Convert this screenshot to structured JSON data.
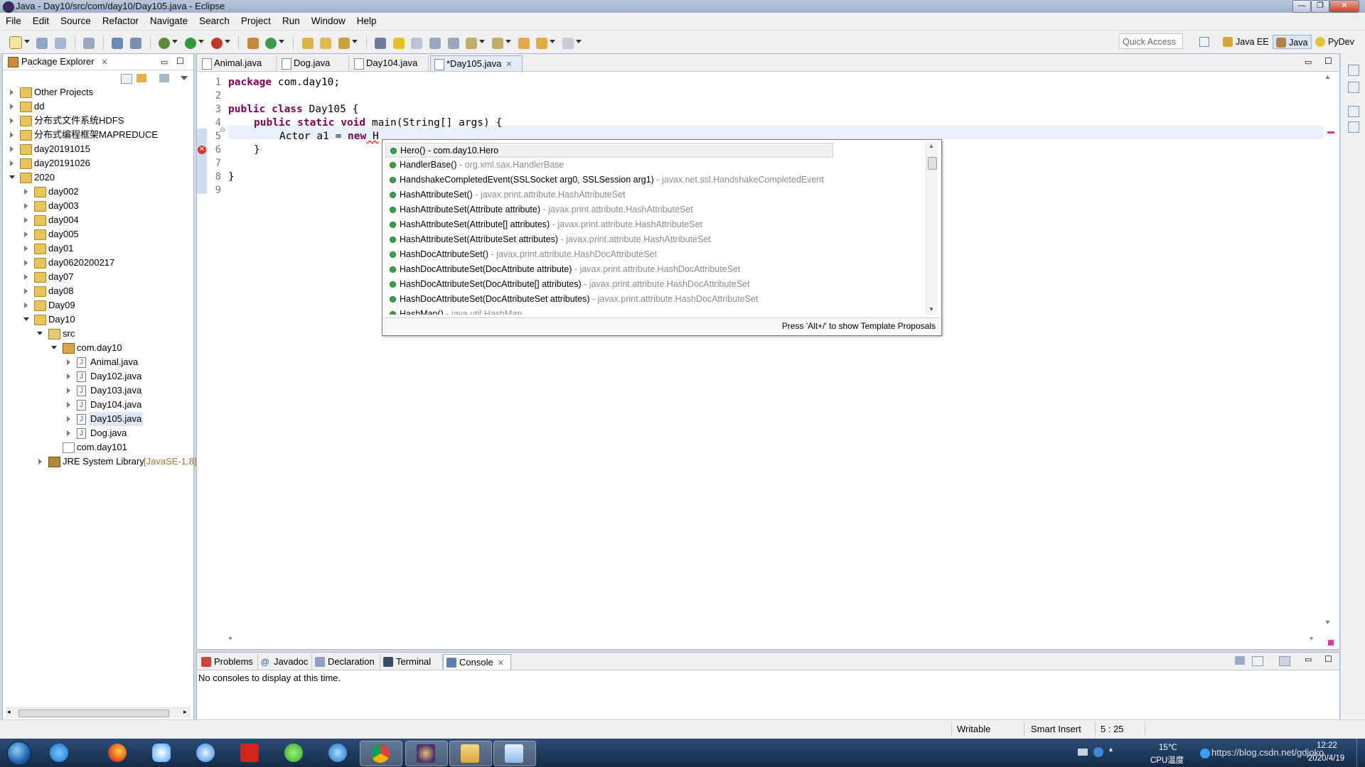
{
  "window": {
    "title": "Java - Day10/src/com/day10/Day105.java - Eclipse",
    "controls": [
      "—",
      "❐",
      "✕"
    ]
  },
  "menubar": [
    "File",
    "Edit",
    "Source",
    "Refactor",
    "Navigate",
    "Search",
    "Project",
    "Run",
    "Window",
    "Help"
  ],
  "toolbar": {
    "quick_access": "Quick Access",
    "perspectives": [
      "Java EE",
      "Java",
      "PyDev"
    ]
  },
  "package_explorer": {
    "title": "Package Explorer",
    "items": [
      {
        "label": "Other Projects"
      },
      {
        "label": "dd"
      },
      {
        "label": "分布式文件系统HDFS"
      },
      {
        "label": "分布式编程框架MAPREDUCE"
      },
      {
        "label": "day20191015"
      },
      {
        "label": "day20191026"
      },
      {
        "label": "2020"
      },
      {
        "label": "day002"
      },
      {
        "label": "day003"
      },
      {
        "label": "day004"
      },
      {
        "label": "day005"
      },
      {
        "label": "day01"
      },
      {
        "label": "day0620200217"
      },
      {
        "label": "day07"
      },
      {
        "label": "day08"
      },
      {
        "label": "Day09"
      },
      {
        "label": "Day10"
      },
      {
        "label": "src"
      },
      {
        "label": "com.day10"
      },
      {
        "label": "Animal.java"
      },
      {
        "label": "Day102.java"
      },
      {
        "label": "Day103.java"
      },
      {
        "label": "Day104.java"
      },
      {
        "label": "Day105.java"
      },
      {
        "label": "Dog.java"
      },
      {
        "label": "com.day101"
      },
      {
        "label": "JRE System Library",
        "decoration": "[JavaSE-1.8]"
      }
    ]
  },
  "editor": {
    "tabs": [
      "Animal.java",
      "Dog.java",
      "Day104.java",
      "*Day105.java"
    ],
    "line_numbers": [
      "1",
      "2",
      "3",
      "4",
      "5",
      "6",
      "7",
      "8",
      "9"
    ],
    "code": {
      "l1_kw": "package",
      "l1_rest": " com.day10;",
      "l3_kw": "public class",
      "l3_rest": " Day105 {",
      "l4_kw1": "public static void",
      "l4_rest": " main(String[] args) {",
      "l5_a": "Actor a1 = ",
      "l5_kw": "new",
      "l5_b": " H",
      "l6": "}",
      "l8": "}"
    }
  },
  "content_assist": {
    "proposals": [
      {
        "name": "Hero()",
        "qualifier": " - com.day10.Hero"
      },
      {
        "name": "HandlerBase()",
        "qualifier": " - org.xml.sax.HandlerBase"
      },
      {
        "name": "HandshakeCompletedEvent(SSLSocket arg0, SSLSession arg1)",
        "qualifier": " - javax.net.ssl.HandshakeCompletedEvent"
      },
      {
        "name": "HashAttributeSet()",
        "qualifier": " - javax.print.attribute.HashAttributeSet"
      },
      {
        "name": "HashAttributeSet(Attribute attribute)",
        "qualifier": " - javax.print.attribute.HashAttributeSet"
      },
      {
        "name": "HashAttributeSet(Attribute[] attributes)",
        "qualifier": " - javax.print.attribute.HashAttributeSet"
      },
      {
        "name": "HashAttributeSet(AttributeSet attributes)",
        "qualifier": " - javax.print.attribute.HashAttributeSet"
      },
      {
        "name": "HashDocAttributeSet()",
        "qualifier": " - javax.print.attribute.HashDocAttributeSet"
      },
      {
        "name": "HashDocAttributeSet(DocAttribute attribute)",
        "qualifier": " - javax.print.attribute.HashDocAttributeSet"
      },
      {
        "name": "HashDocAttributeSet(DocAttribute[] attributes)",
        "qualifier": " - javax.print.attribute.HashDocAttributeSet"
      },
      {
        "name": "HashDocAttributeSet(DocAttributeSet attributes)",
        "qualifier": " - javax.print.attribute.HashDocAttributeSet"
      },
      {
        "name": "HashMap()",
        "qualifier": " - java.util.HashMap"
      }
    ],
    "status": "Press 'Alt+/' to show Template Proposals"
  },
  "bottom_panel": {
    "tabs": [
      "Problems",
      "Javadoc",
      "Declaration",
      "Terminal",
      "Console"
    ],
    "message": "No consoles to display at this time."
  },
  "status_bar": {
    "writable": "Writable",
    "insert_mode": "Smart Insert",
    "position": "5 : 25"
  },
  "taskbar": {
    "apps": [
      "ie-icon",
      "firefox-icon",
      "baidu-netdisk-icon",
      "onedrive-icon",
      "youdao-icon",
      "360-icon",
      "ie-blue-icon",
      "chrome-icon",
      "eclipse-icon",
      "explorer-icon",
      "notepad-icon"
    ],
    "temperature": "15℃",
    "cpu_label": "CPU温度",
    "time": "12:22",
    "date": "2020/4/19",
    "watermark": "https://blog.csdn.net/gdjoko"
  },
  "colors": {
    "keyword": "#7f0055",
    "current_line": "#e8f2fe",
    "proposal_dot": "#3aa04a",
    "qualifier": "#8b8b8b",
    "decoration": "#a0782c"
  }
}
